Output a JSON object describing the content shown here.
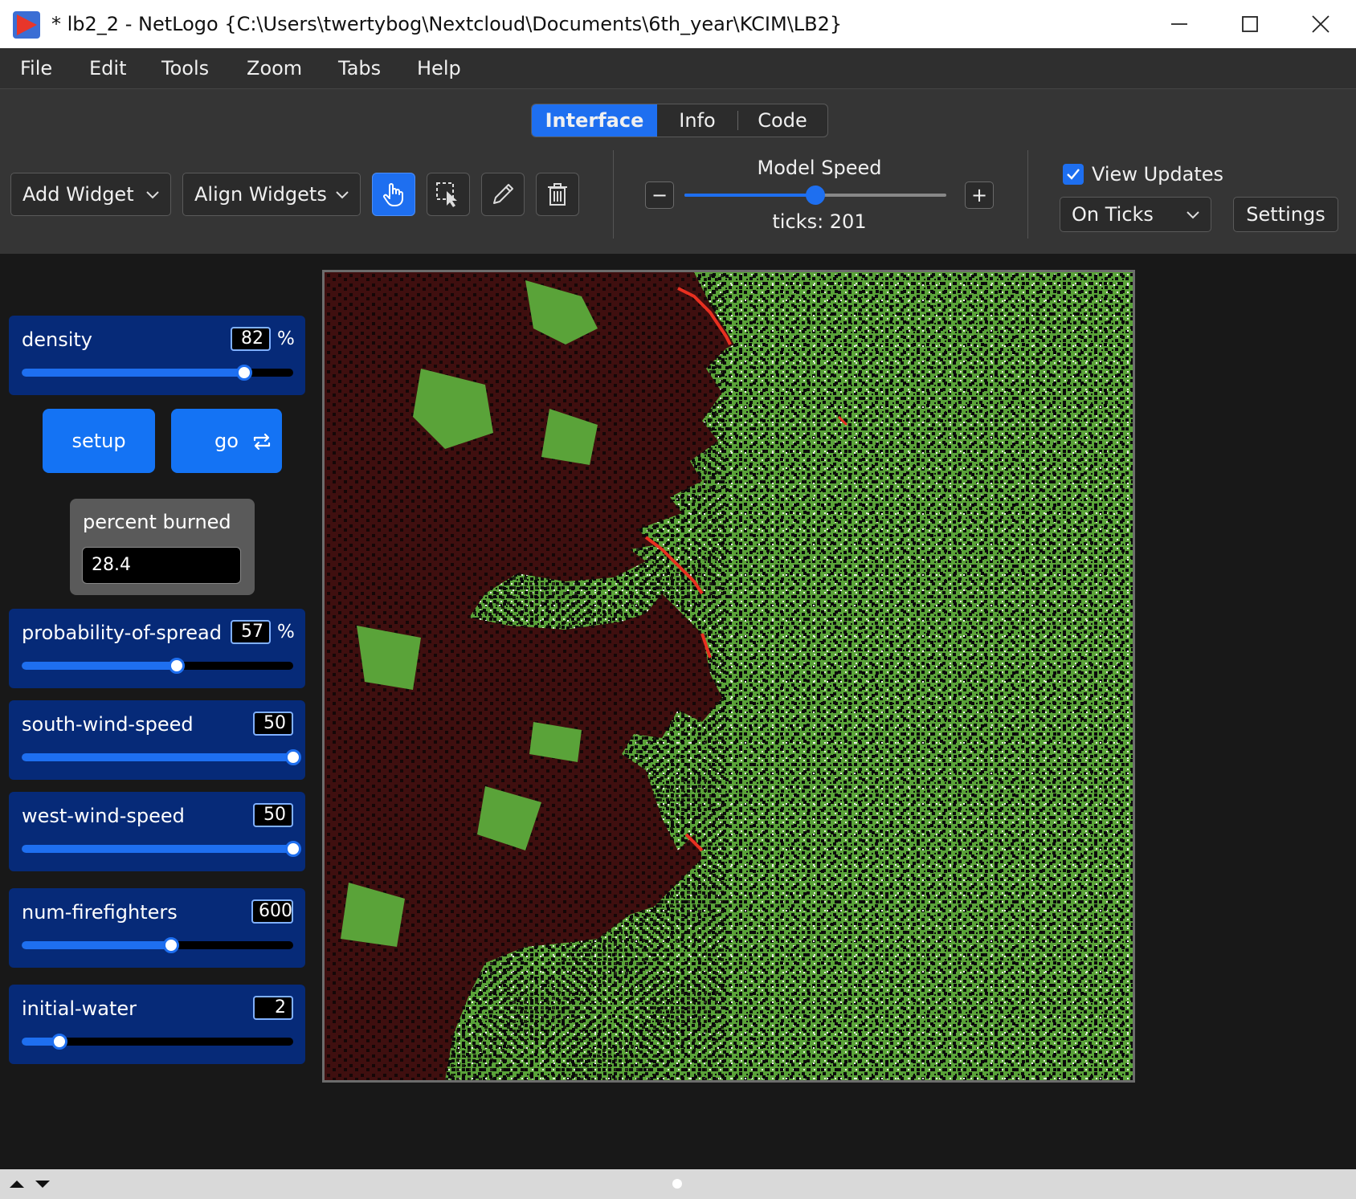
{
  "window": {
    "title": "* lb2_2 - NetLogo {C:\\Users\\twertybog\\Nextcloud\\Documents\\6th_year\\KCIM\\LB2}"
  },
  "menu": {
    "file": "File",
    "edit": "Edit",
    "tools": "Tools",
    "zoom": "Zoom",
    "tabs": "Tabs",
    "help": "Help"
  },
  "tabs": {
    "interface": "Interface",
    "info": "Info",
    "code": "Code",
    "active": "Interface"
  },
  "toolbar": {
    "add_widget": "Add Widget",
    "align_widgets": "Align Widgets",
    "model_speed_label": "Model Speed",
    "ticks": "ticks: 201",
    "speed_minus": "−",
    "speed_plus": "+",
    "model_speed_fraction": 0.5,
    "view_updates_label": "View Updates",
    "view_updates_checked": true,
    "update_mode": "On Ticks",
    "settings": "Settings",
    "icons": [
      "interact-hand-icon",
      "select-icon",
      "edit-pencil-icon",
      "delete-trash-icon"
    ]
  },
  "widgets": {
    "density": {
      "name": "density",
      "value": "82",
      "unit": "%",
      "min": 0,
      "max": 99,
      "fraction": 0.82
    },
    "setup": {
      "label": "setup"
    },
    "go": {
      "label": "go",
      "forever": true
    },
    "percent_burned": {
      "name": "percent burned",
      "value": "28.4"
    },
    "probability_of_spread": {
      "name": "probability-of-spread",
      "value": "57",
      "unit": "%",
      "fraction": 0.57
    },
    "south_wind_speed": {
      "name": "south-wind-speed",
      "value": "50",
      "fraction": 1.0
    },
    "west_wind_speed": {
      "name": "west-wind-speed",
      "value": "50",
      "fraction": 1.0
    },
    "num_firefighters": {
      "name": "num-firefighters",
      "value": "600",
      "fraction": 0.55
    },
    "initial_water": {
      "name": "initial-water",
      "value": "2",
      "fraction": 0.14
    }
  },
  "colors": {
    "accent": "#1e6ff0",
    "slider_bg": "#062a78",
    "tree_green": "#5aa339",
    "burnt": "#3f0f0f",
    "fire": "#e83020",
    "empty": "#000000"
  }
}
